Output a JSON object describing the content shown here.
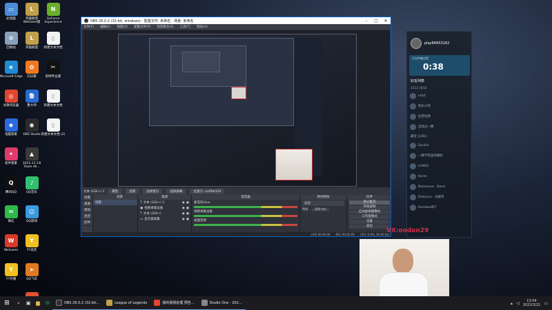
{
  "desktop_icons": [
    {
      "label": "此电脑",
      "color": "#4a8cd6",
      "glyph": "▭"
    },
    {
      "label": "回收站",
      "color": "#8aa0b8",
      "glyph": "♻"
    },
    {
      "label": "Microsoft Edge",
      "color": "#1f8ad6",
      "glyph": "e"
    },
    {
      "label": "谷歌浏览器",
      "color": "#e2452f",
      "glyph": "◎"
    },
    {
      "label": "电脑管家",
      "color": "#2a6ae0",
      "glyph": "◆"
    },
    {
      "label": "软件管家",
      "color": "#e03a6a",
      "glyph": "✦"
    },
    {
      "label": "腾讯QQ",
      "color": "#111",
      "glyph": "Q"
    },
    {
      "label": "微信",
      "color": "#2fb84a",
      "glyph": "✉"
    },
    {
      "label": "WeGame",
      "color": "#d83a2a",
      "glyph": "W"
    },
    {
      "label": "YY开播",
      "color": "#f0c020",
      "glyph": "Y"
    },
    {
      "label": "英雄联盟 WeGame版",
      "color": "#c2a04a",
      "glyph": "L"
    },
    {
      "label": "英雄联盟",
      "color": "#c2a04a",
      "glyph": "L"
    },
    {
      "label": "向日葵",
      "color": "#f07a20",
      "glyph": "✿"
    },
    {
      "label": "鲁大师",
      "color": "#2a6ad0",
      "glyph": "鲁"
    },
    {
      "label": "OBS Studio",
      "color": "#2b2b2b",
      "glyph": "◉"
    },
    {
      "label": "2021-11-18 Team All...",
      "color": "#3a3a3a",
      "glyph": "▲"
    },
    {
      "label": "QQ音乐",
      "color": "#30c070",
      "glyph": "♪"
    },
    {
      "label": "QQ游戏",
      "color": "#3a9ae0",
      "glyph": "☺"
    },
    {
      "label": "YY语音",
      "color": "#f0c020",
      "glyph": "Y"
    },
    {
      "label": "QQ飞车",
      "color": "#e07a20",
      "glyph": "➤"
    },
    {
      "label": "英雄时运通",
      "color": "#e05030",
      "glyph": "◉"
    },
    {
      "label": "GeForce Experience",
      "color": "#6aae2a",
      "glyph": "N"
    },
    {
      "label": "新建文本文档",
      "color": "#f4f4f4",
      "glyph": "▯"
    },
    {
      "label": "剪映专业版",
      "color": "#111",
      "glyph": "✂"
    },
    {
      "label": "新建文本文档",
      "color": "#f4f4f4",
      "glyph": "▯"
    },
    {
      "label": "新建文本文档 (2)",
      "color": "#f4f4f4",
      "glyph": "▯"
    }
  ],
  "obs": {
    "title": "OBS 26.0.2 (32-bit, windows) - 配置文件: 未命名 - 场景: 未命名",
    "menu": [
      "文件(F)",
      "编辑(E)",
      "视图(V)",
      "配置文件(P)",
      "场景集合(S)",
      "工具(T)",
      "帮助(H)"
    ],
    "source_label": "文本 (GDI+) 2",
    "toolbar_buttons": [
      "属性",
      "滤镜",
      "选择窗口",
      "选择屏幕",
      "主窗口: ssdf9b329"
    ],
    "docks": {
      "scenes": {
        "title": "场景",
        "items": [
          "场景"
        ]
      },
      "sources": {
        "title": "来源",
        "items": [
          "文本 (GDI+) 3",
          "视频采集设备",
          "文本 (GDI+)",
          "显示器采集"
        ]
      },
      "mixer": {
        "title": "混音器",
        "items": [
          "麦克风/Aux",
          "视频采集设备",
          "桌面音频"
        ]
      },
      "transitions": {
        "title": "转场特效",
        "items": [
          "淡出",
          "时长",
          "300 ms"
        ]
      },
      "controls": {
        "title": "控件",
        "items": [
          "停止推流",
          "开始录制",
          "启动虚拟摄像机",
          "工作室模式",
          "设置",
          "退出"
        ]
      }
    },
    "side_tabs": [
      "场景",
      "来源",
      "转场",
      "混音",
      "控件"
    ],
    "status": [
      "LIVE 00:00:00",
      "REC 00:00:00",
      "CPU: 6.9%, 60.00 fps"
    ]
  },
  "qq": {
    "username": "play8A653162",
    "timer_label": "正在传输过程",
    "timer": "0:38",
    "friends_title": "好友列表",
    "group1": "1111 (0/3)",
    "group2": "最近 (1/81)",
    "friends": [
      "orbit",
      "快乐小鸡",
      "拉普拉斯",
      "出现过一瞬",
      "Duckie",
      "一颗不完美的精彩",
      "LUNAX",
      "Kerim",
      "Numerous · Band",
      "Distance · 光痕市",
      "Darkbee轩T"
    ]
  },
  "watermark": "VX:oodan29",
  "taskbar": {
    "items": [
      "OBS 26.0.2 (32-bit...",
      "League of Legends",
      "我的视频处理 预告...",
      "Studio One - 202..."
    ],
    "time": "13:54",
    "date": "2022/3/21"
  }
}
